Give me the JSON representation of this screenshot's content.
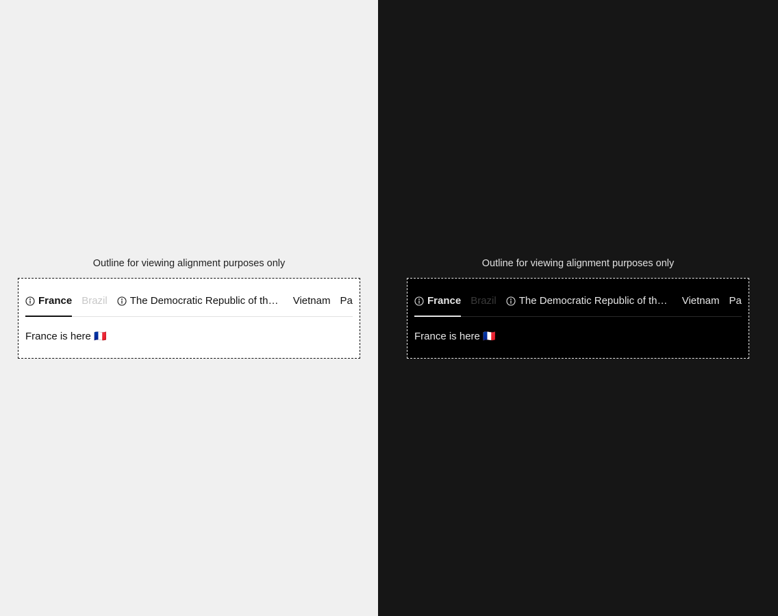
{
  "note": "Outline for viewing alignment purposes only",
  "tabs": [
    {
      "label": "France",
      "has_info_icon": true,
      "selected": true,
      "disabled": false
    },
    {
      "label": "Brazil",
      "has_info_icon": false,
      "selected": false,
      "disabled": true
    },
    {
      "label": "The Democratic Republic of the ...",
      "has_info_icon": true,
      "selected": false,
      "disabled": false
    },
    {
      "label": "Vietnam",
      "has_info_icon": false,
      "selected": false,
      "disabled": false
    },
    {
      "label": "Pa",
      "has_info_icon": false,
      "selected": false,
      "disabled": false
    }
  ],
  "panel": {
    "text": "France is here 🇫🇷"
  },
  "themes": {
    "light_background": "#f0f0f0",
    "dark_background": "#161616"
  }
}
